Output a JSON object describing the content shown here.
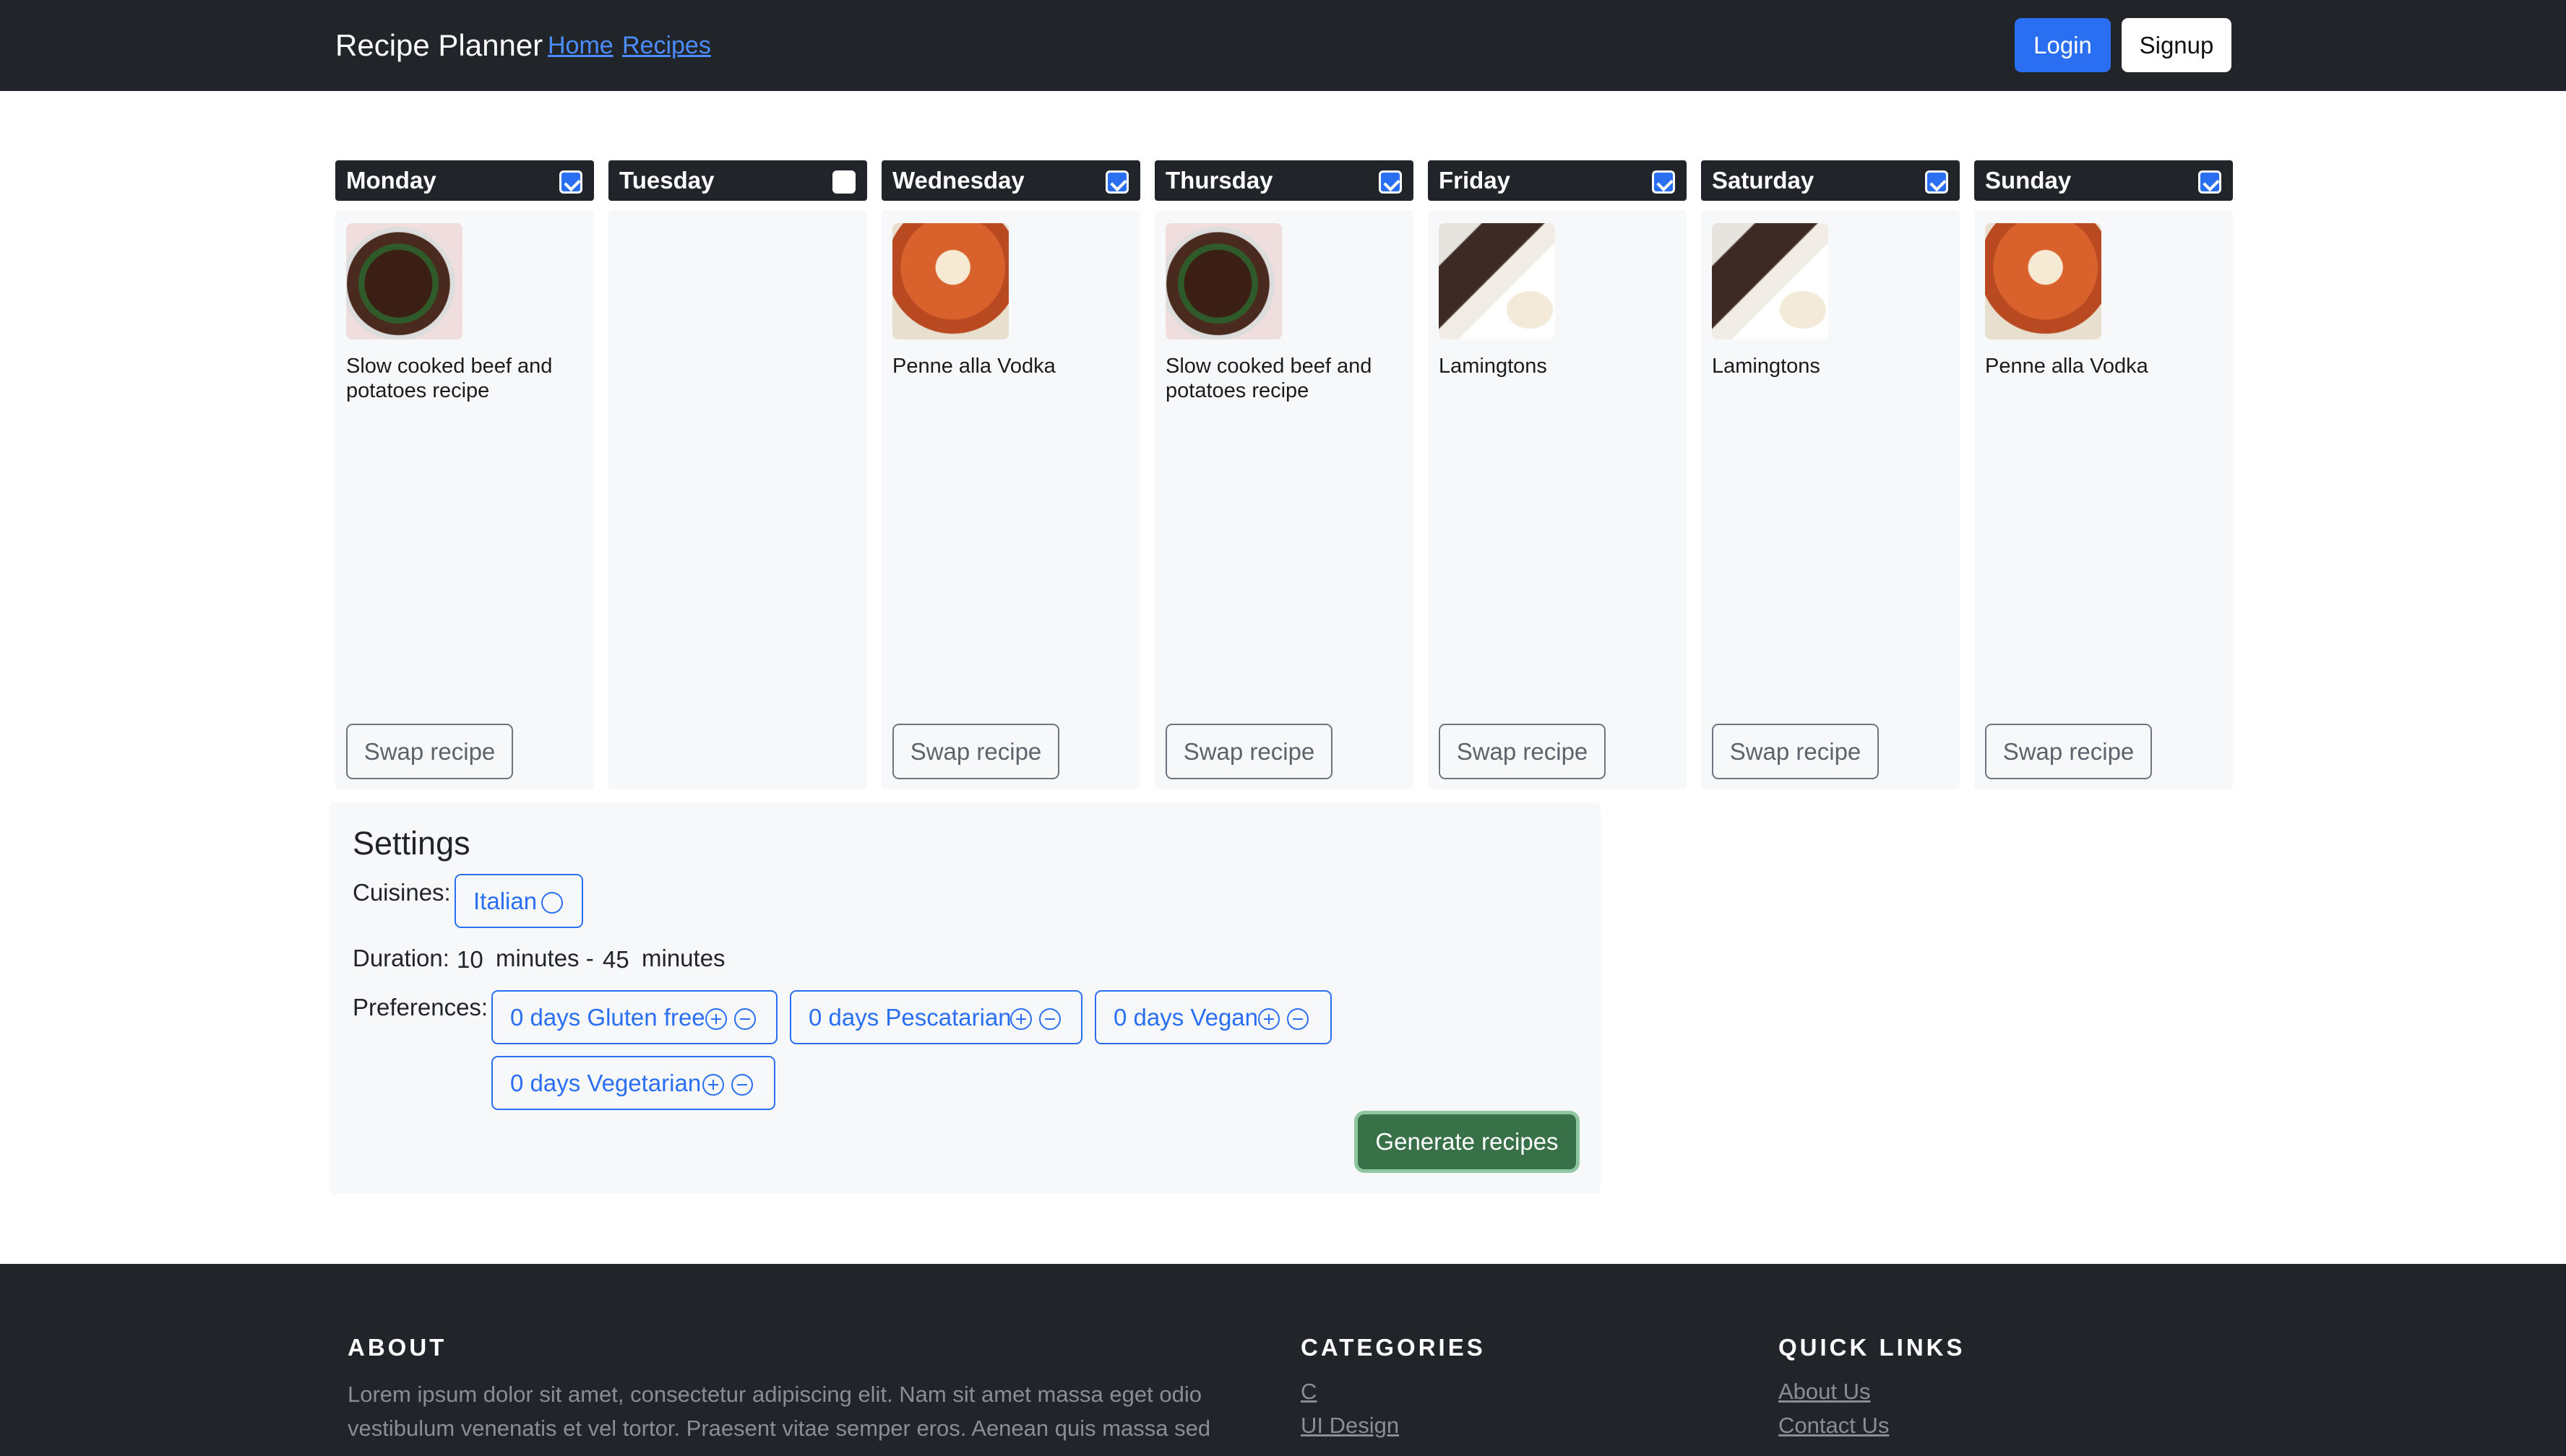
{
  "navbar": {
    "brand": "Recipe Planner",
    "links": [
      "Home",
      "Recipes"
    ],
    "login": "Login",
    "signup": "Signup"
  },
  "days": [
    {
      "name": "Monday",
      "checked": true,
      "recipe": "Slow cooked beef and potatoes recipe",
      "image": "beef",
      "swap": "Swap recipe"
    },
    {
      "name": "Tuesday",
      "checked": false,
      "recipe": "",
      "image": "",
      "swap": ""
    },
    {
      "name": "Wednesday",
      "checked": true,
      "recipe": "Penne alla Vodka",
      "image": "penne",
      "swap": "Swap recipe"
    },
    {
      "name": "Thursday",
      "checked": true,
      "recipe": "Slow cooked beef and potatoes recipe",
      "image": "beef",
      "swap": "Swap recipe"
    },
    {
      "name": "Friday",
      "checked": true,
      "recipe": "Lamingtons",
      "image": "lamington",
      "swap": "Swap recipe"
    },
    {
      "name": "Saturday",
      "checked": true,
      "recipe": "Lamingtons",
      "image": "lamington",
      "swap": "Swap recipe"
    },
    {
      "name": "Sunday",
      "checked": true,
      "recipe": "Penne alla Vodka",
      "image": "penne",
      "swap": "Swap recipe"
    }
  ],
  "settings": {
    "title": "Settings",
    "cuisines_label": "Cuisines:",
    "cuisines": [
      "Italian"
    ],
    "duration_label": "Duration:",
    "duration_min": "10",
    "minutes_dash": "minutes -",
    "duration_max": "45",
    "minutes": "minutes",
    "preferences_label": "Preferences:",
    "preferences": [
      "0 days Gluten free",
      "0 days Pescatarian",
      "0 days Vegan",
      "0 days Vegetarian"
    ],
    "generate": "Generate recipes"
  },
  "footer": {
    "about_title": "ABOUT",
    "about_text": "Lorem ipsum dolor sit amet, consectetur adipiscing elit. Nam sit amet massa eget odio vestibulum venenatis et vel tortor. Praesent vitae semper eros. Aenean quis massa sed eros",
    "categories_title": "CATEGORIES",
    "categories": [
      "C",
      "UI Design"
    ],
    "quick_links_title": "QUICK LINKS",
    "quick_links": [
      "About Us",
      "Contact Us"
    ]
  },
  "colors": {
    "navbar": "#212529",
    "primary": "#2a6ff1",
    "success": "#387148",
    "panel": "#f7f8f9"
  }
}
